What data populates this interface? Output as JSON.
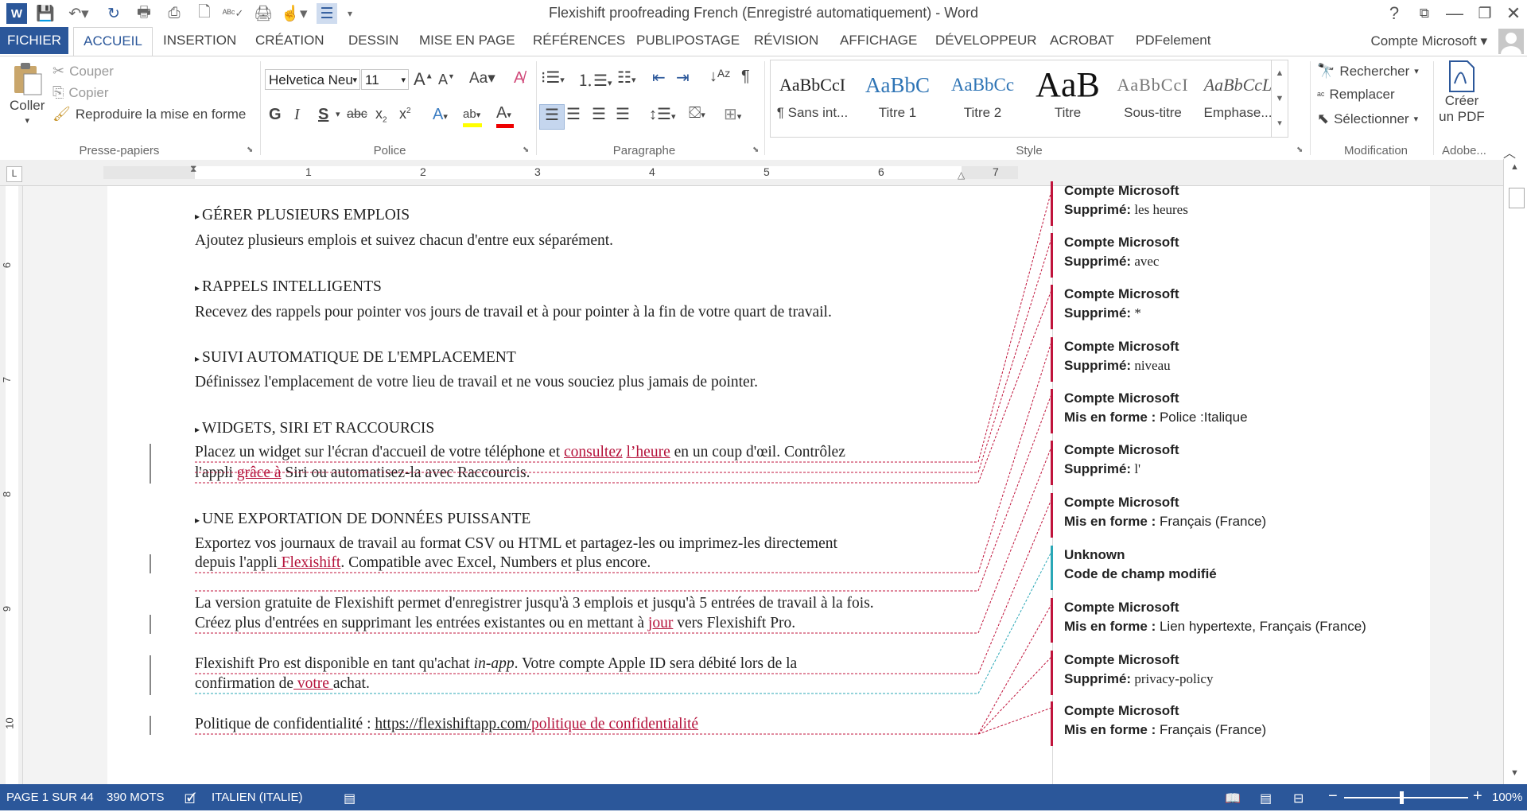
{
  "window": {
    "title": "Flexishift proofreading French (Enregistré automatiquement) - Word",
    "help": "?",
    "account": "Compte Microsoft"
  },
  "tabs": [
    "FICHIER",
    "ACCUEIL",
    "INSERTION",
    "CRÉATION",
    "DESSIN",
    "MISE EN PAGE",
    "RÉFÉRENCES",
    "PUBLIPOSTAGE",
    "RÉVISION",
    "AFFICHAGE",
    "DÉVELOPPEUR",
    "ACROBAT",
    "PDFelement"
  ],
  "ribbon": {
    "clipboard": {
      "paste": "Coller",
      "cut": "Couper",
      "copy": "Copier",
      "format_painter": "Reproduire la mise en forme",
      "label": "Presse-papiers"
    },
    "font": {
      "name": "Helvetica Neu",
      "size": "11",
      "label": "Police"
    },
    "paragraph": {
      "label": "Paragraphe"
    },
    "styles": {
      "label": "Style",
      "items": [
        {
          "sample": "AaBbCcI",
          "name": "¶ Sans int..."
        },
        {
          "sample": "AaBbC",
          "name": "Titre 1"
        },
        {
          "sample": "AaBbCc",
          "name": "Titre 2"
        },
        {
          "sample": "AaB",
          "name": "Titre"
        },
        {
          "sample": "AaBbCcI",
          "name": "Sous-titre"
        },
        {
          "sample": "AaBbCcL",
          "name": "Emphase..."
        }
      ]
    },
    "editing": {
      "find": "Rechercher",
      "replace": "Remplacer",
      "select": "Sélectionner",
      "label": "Modification"
    },
    "adobe": {
      "create_line1": "Créer",
      "create_line2": "un PDF",
      "label": "Adobe..."
    }
  },
  "ruler": {
    "numbers": [
      "1",
      "2",
      "3",
      "4",
      "5",
      "6",
      "7"
    ],
    "vnumbers": [
      "6",
      "7",
      "8",
      "9",
      "10"
    ]
  },
  "document": {
    "h1": "GÉRER PLUSIEURS EMPLOIS",
    "p1": "Ajoutez plusieurs emplois et suivez chacun d'entre eux séparément.",
    "h2": "RAPPELS INTELLIGENTS",
    "p2": "Recevez des rappels pour pointer vos jours de travail et à pour pointer à la fin de votre quart de travail.",
    "h3": "SUIVI AUTOMATIQUE DE L'EMPLACEMENT",
    "p3": "Définissez l'emplacement de votre lieu de travail et ne vous souciez plus jamais de pointer.",
    "h4": "WIDGETS, SIRI ET RACCOURCIS",
    "p4a_1": "Placez un widget sur l'écran d'accueil de votre téléphone et ",
    "p4a_ins1": "consultez",
    "p4a_2": " ",
    "p4a_ins2": "l’heure",
    "p4a_3": " en un coup d'œil. Contrôlez",
    "p4b_1": "l'appli ",
    "p4b_ins": "grâce à",
    "p4b_2": " Siri ou automatisez-la avec Raccourcis.",
    "h5": "UNE EXPORTATION DE DONNÉES PUISSANTE",
    "p5a": "Exportez vos journaux de travail au format CSV ou HTML et partagez-les ou imprimez-les directement",
    "p5b_1": "depuis l'appli",
    "p5b_ins": " Flexishift",
    "p5b_2": ". Compatible avec Excel, Numbers et plus encore.",
    "p6a": "La version gratuite de Flexishift permet d'enregistrer jusqu'à 3 emplois et jusqu'à 5 entrées de travail à la fois.",
    "p6b_1": "Créez plus d'entrées en supprimant les entrées existantes ou en mettant à ",
    "p6b_ins": "jour",
    "p6b_2": " vers Flexishift Pro.",
    "p7a_1": "Flexishift Pro est disponible en tant qu'achat ",
    "p7a_it": "in-app",
    "p7a_2": ". Votre compte Apple ID sera débité lors de la",
    "p7b_1": "confirmation de",
    "p7b_ins": " votre ",
    "p7b_2": "achat.",
    "p8_1": "Politique de confidentialité : ",
    "p8_link": "https://flexishiftapp.com/",
    "p8_ins": "politique de confidentialité"
  },
  "comments": [
    {
      "author": "Compte Microsoft",
      "kind": "Supprimé:",
      "text": "les heures",
      "serif": true,
      "color": "#c0143c"
    },
    {
      "author": "Compte Microsoft",
      "kind": "Supprimé:",
      "text": "avec",
      "serif": true,
      "color": "#c0143c"
    },
    {
      "author": "Compte Microsoft",
      "kind": "Supprimé:",
      "text": "*",
      "serif": true,
      "color": "#c0143c"
    },
    {
      "author": "Compte Microsoft",
      "kind": "Supprimé:",
      "text": "niveau",
      "serif": true,
      "color": "#c0143c"
    },
    {
      "author": "Compte Microsoft",
      "kind": "Mis en forme :",
      "text": "Police :Italique",
      "serif": false,
      "color": "#c0143c"
    },
    {
      "author": "Compte Microsoft",
      "kind": "Supprimé:",
      "text": "l'",
      "serif": true,
      "color": "#c0143c"
    },
    {
      "author": "Compte Microsoft",
      "kind": "Mis en forme :",
      "text": "Français (France)",
      "serif": false,
      "color": "#c0143c"
    },
    {
      "author": "Unknown",
      "kind": "Code de champ modifié",
      "text": "",
      "serif": false,
      "color": "#2aa7b6"
    },
    {
      "author": "Compte Microsoft",
      "kind": "Mis en forme :",
      "text": "Lien hypertexte, Français (France)",
      "serif": false,
      "color": "#c0143c"
    },
    {
      "author": "Compte Microsoft",
      "kind": "Supprimé:",
      "text": "privacy-policy",
      "serif": true,
      "color": "#c0143c"
    },
    {
      "author": "Compte Microsoft",
      "kind": "Mis en forme :",
      "text": "Français (France)",
      "serif": false,
      "color": "#c0143c"
    }
  ],
  "status": {
    "page": "PAGE 1 SUR 44",
    "words": "390 MOTS",
    "language": "ITALIEN (ITALIE)",
    "zoom": "100%"
  },
  "colors": {
    "accent": "#2b579a",
    "revision": "#c0143c",
    "field": "#2aa7b6"
  }
}
